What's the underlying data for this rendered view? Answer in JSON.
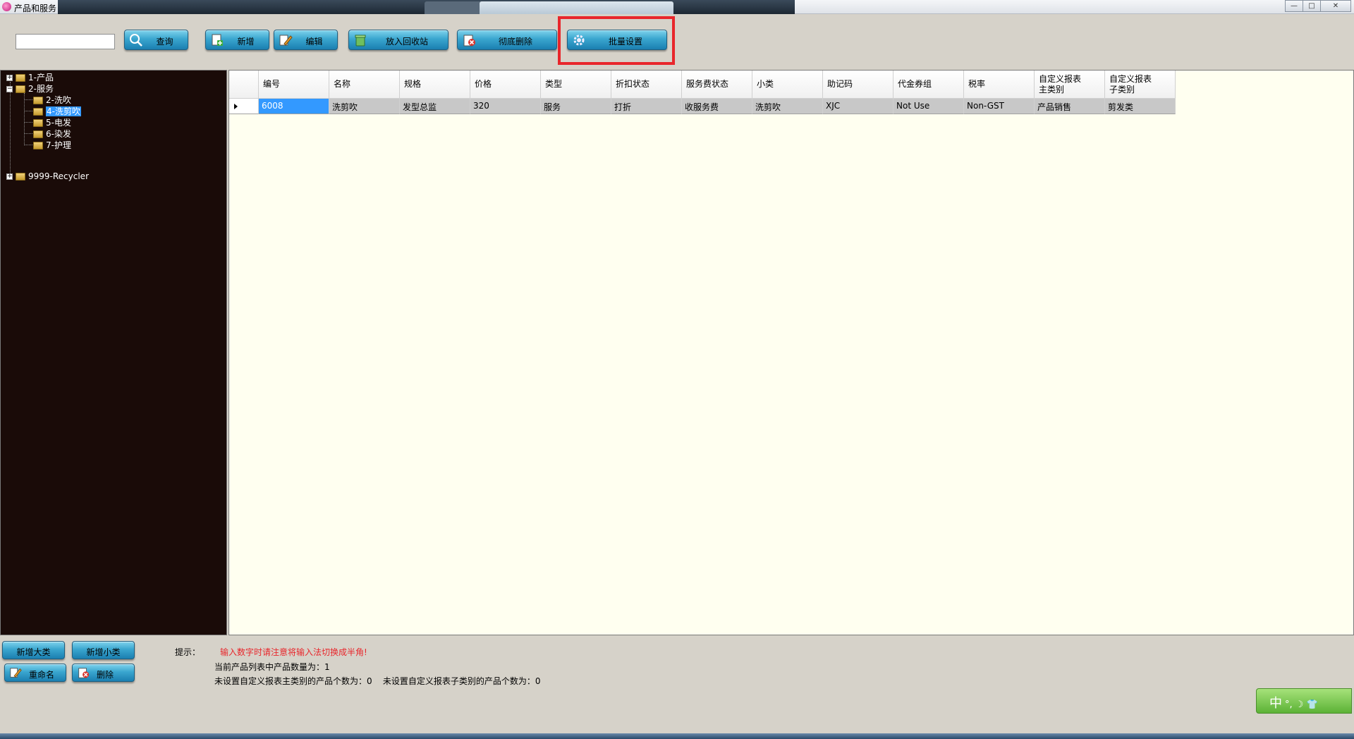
{
  "window": {
    "title": "产品和服务",
    "controls": {
      "minimize": "—",
      "maximize": "□",
      "close": "✕"
    }
  },
  "toolbar": {
    "search_value": "",
    "query_label": "查询",
    "add_label": "新增",
    "edit_label": "编辑",
    "recycle_label": "放入回收站",
    "delete_label": "彻底删除",
    "batch_label": "批量设置"
  },
  "tree": {
    "nodes": [
      {
        "label": "1-产品",
        "expander": "+"
      },
      {
        "label": "2-服务",
        "expander": "−"
      },
      {
        "label": "2-洗吹"
      },
      {
        "label": "4-洗剪吹"
      },
      {
        "label": "5-电发"
      },
      {
        "label": "6-染发"
      },
      {
        "label": "7-护理"
      },
      {
        "label": "9999-Recycler",
        "expander": "+"
      }
    ]
  },
  "grid": {
    "columns": [
      "编号",
      "名称",
      "规格",
      "价格",
      "类型",
      "折扣状态",
      "服务费状态",
      "小类",
      "助记码",
      "代金券组",
      "税率",
      "自定义报表主类别",
      "自定义报表子类别"
    ],
    "columns_two_line": [
      [
        "自定义报表",
        "主类别"
      ],
      [
        "自定义报表",
        "子类别"
      ]
    ],
    "rows": [
      [
        "6008",
        "洗剪吹",
        "发型总监",
        "320",
        "服务",
        "打折",
        "收服务费",
        "洗剪吹",
        "XJC",
        "Not Use",
        "Non-GST",
        "产品销售",
        "剪发类"
      ]
    ]
  },
  "bottom": {
    "add_category_label": "新增大类",
    "add_subcategory_label": "新增小类",
    "rename_label": "重命名",
    "delete_label": "删除",
    "hint_label": "提示：",
    "hint_text": "输入数字时请注意将输入法切换成半角!",
    "count_text": "当前产品列表中产品数量为：1",
    "unset_text": "未设置自定义报表主类别的产品个数为：0    未设置自定义报表子类别的产品个数为：0"
  },
  "ime": {
    "label": "中",
    "extras": "°, ☽ 👕"
  },
  "colors": {
    "button_top": "#7fd3ec",
    "button_bottom": "#1b7fb0",
    "highlight": "#e8262b",
    "tree_bg": "#1a0b08",
    "grid_bg": "#fffff0",
    "selection": "#3399ff"
  }
}
